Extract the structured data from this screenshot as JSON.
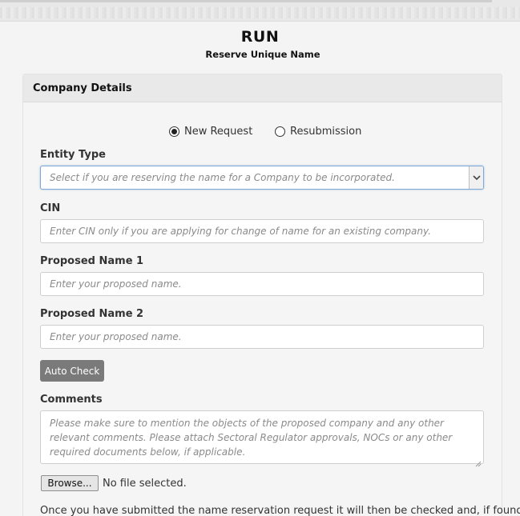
{
  "header": {
    "logo_text": "RUN",
    "subtitle": "Reserve Unique Name"
  },
  "panel": {
    "title": "Company Details"
  },
  "request_type": {
    "options": [
      {
        "label": "New Request",
        "selected": true
      },
      {
        "label": "Resubmission",
        "selected": false
      }
    ]
  },
  "form": {
    "entity_type": {
      "label": "Entity Type",
      "placeholder": "Select if you are reserving the name for a Company to be incorporated.",
      "value": ""
    },
    "cin": {
      "label": "CIN",
      "placeholder": "Enter CIN only if you are applying for change of name for an existing company.",
      "value": ""
    },
    "proposed_name_1": {
      "label": "Proposed Name 1",
      "placeholder": "Enter your proposed name.",
      "value": ""
    },
    "proposed_name_2": {
      "label": "Proposed Name 2",
      "placeholder": "Enter your proposed name.",
      "value": ""
    },
    "auto_check_label": "Auto Check",
    "comments": {
      "label": "Comments",
      "placeholder": "Please make sure to mention the objects of the proposed company and any other relevant comments. Please attach Sectoral Regulator approvals, NOCs or any other required documents below, if applicable.",
      "value": ""
    },
    "file": {
      "browse_label": "Browse...",
      "status": "No file selected."
    }
  },
  "footer": {
    "text": "Once you have submitted the name reservation request it will then be checked and, if found"
  },
  "colors": {
    "page_bg": "#f4f4f4",
    "panel_header_bg": "#e9e9e9",
    "button_bg": "#7a7a7a",
    "focus_border": "#7ea7d4"
  }
}
